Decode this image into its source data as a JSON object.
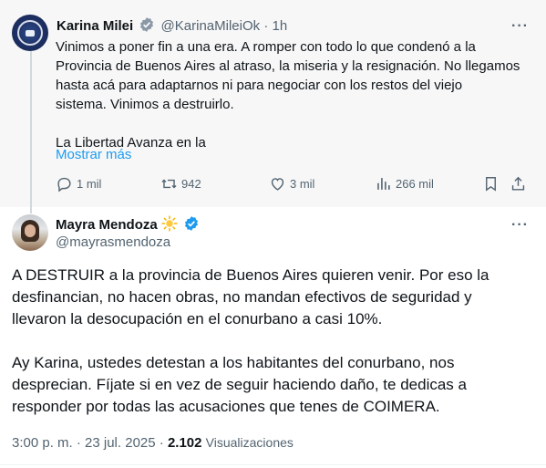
{
  "quoted_post": {
    "author_name": "Karina Milei",
    "handle": "@KarinaMileiOk",
    "separator": "·",
    "time": "1h",
    "more": "···",
    "body_lines": [
      "Vinimos a poner fin a una era. A romper con todo lo que condenó a la",
      "Provincia de Buenos Aires al atraso, la miseria y la resignación. No llegamos",
      "hasta acá para adaptarnos ni para negociar con los restos del viejo",
      "sistema. Vinimos a destruirlo.",
      "",
      "La Libertad Avanza en la"
    ],
    "show_more": "Mostrar más",
    "stats": {
      "replies": "1 mil",
      "reposts": "942",
      "likes": "3 mil",
      "views": "266 mil"
    },
    "accent_color": "#1d9bf0"
  },
  "main_post": {
    "author_name": "Mayra Mendoza",
    "author_emoji": "sun-emoji",
    "handle": "@mayrasmendoza",
    "more": "···",
    "paragraph1": [
      "A DESTRUIR a la provincia de Buenos Aires quieren venir. Por eso la",
      "desfinancian, no hacen obras, no mandan efectivos de seguridad y",
      "llevaron la desocupación en el conurbano a casi 10%."
    ],
    "paragraph2": [
      "Ay Karina, ustedes detestan a los habitantes del conurbano, nos",
      "desprecian. Fíjate si en vez de seguir haciendo daño, te dedicas a",
      "responder por todas las acusaciones que tenes de COIMERA."
    ],
    "timestamp": "3:00 p. m. · 23 jul. 2025 · ",
    "views_count": "2.102",
    "views_label": "Visualizaciones"
  },
  "icons": [
    "verified-badge-icon",
    "reply-icon",
    "repost-icon",
    "like-icon",
    "views-icon",
    "bookmark-icon",
    "share-icon",
    "more-icon"
  ]
}
